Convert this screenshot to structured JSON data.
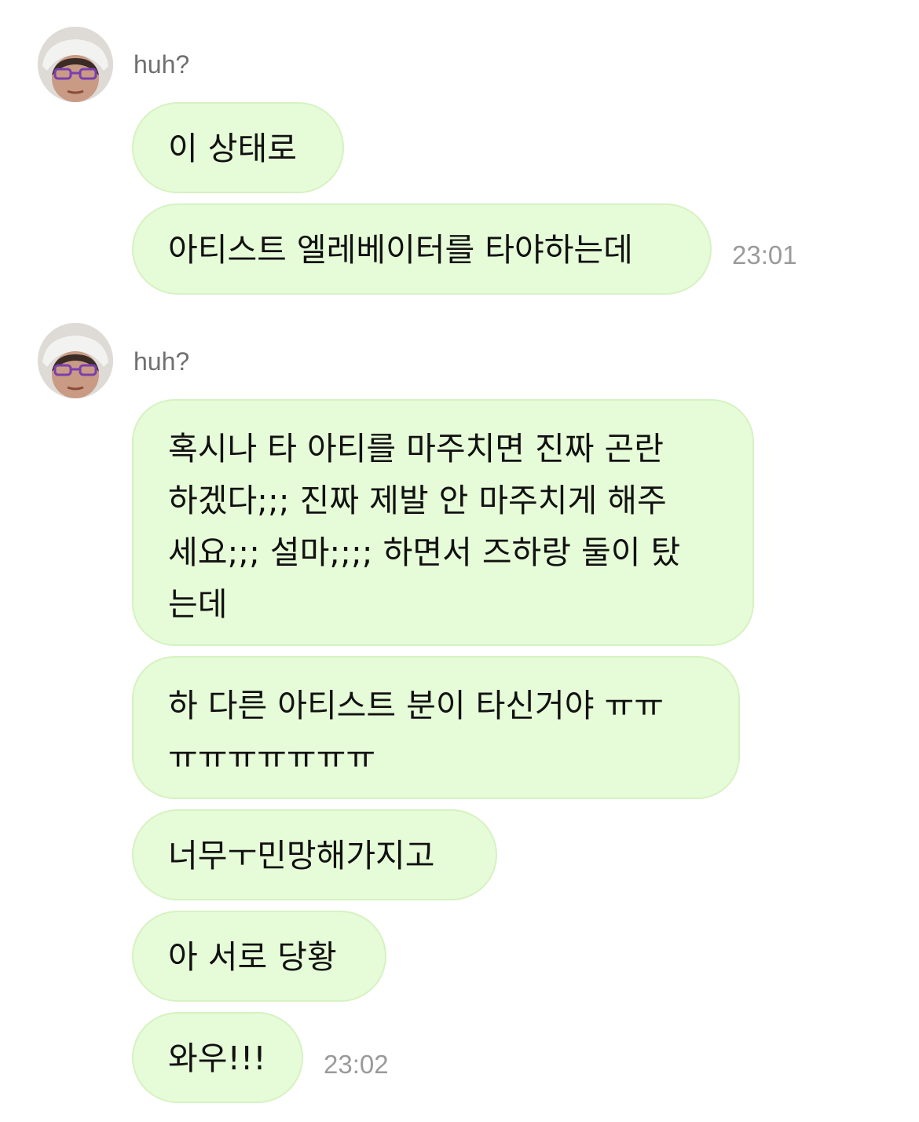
{
  "groups": [
    {
      "sender": "huh?",
      "messages": [
        "이 상태로",
        "아티스트 엘레베이터를 타야하는데"
      ],
      "time": "23:01"
    },
    {
      "sender": "huh?",
      "messages": [
        "혹시나 타 아티를 마주치면 진짜 곤란\n하겠다;;; 진짜 제발 안 마주치게 해주\n세요;;; 설마;;;; 하면서 즈하랑 둘이 탔\n는데",
        "하 다른 아티스트 분이 타신거야 ㅠㅠ\nㅠㅠㅠㅠㅠㅠㅠ",
        "너무ㅜ민망해가지고",
        "아 서로 당황",
        "와우!!!"
      ],
      "time": "23:02"
    }
  ],
  "colors": {
    "bubble_bg": "#e6fbd7",
    "bubble_border": "#d6f2c2",
    "time_text": "#9a9a9a",
    "sender_text": "#6f6f6f"
  },
  "icons": [
    "avatar-photo"
  ]
}
